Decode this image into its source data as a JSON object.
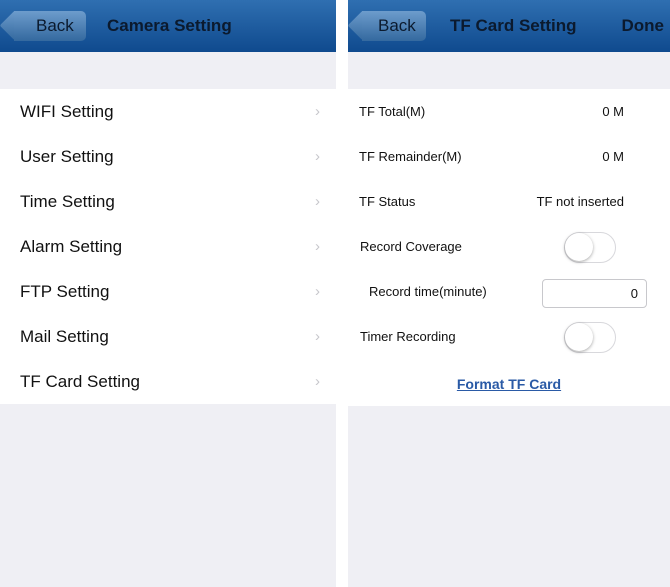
{
  "camera_setting": {
    "back_label": "Back",
    "title": "Camera Setting",
    "items": [
      {
        "label": "WIFI Setting",
        "chevron": "›"
      },
      {
        "label": "User Setting",
        "chevron": "›"
      },
      {
        "label": "Time Setting",
        "chevron": "›"
      },
      {
        "label": "Alarm Setting",
        "chevron": "›"
      },
      {
        "label": "FTP Setting",
        "chevron": "›"
      },
      {
        "label": "Mail Setting",
        "chevron": "›"
      },
      {
        "label": "TF Card Setting",
        "chevron": "›"
      }
    ]
  },
  "tf_card_setting": {
    "back_label": "Back",
    "title": "TF Card Setting",
    "done_label": "Done",
    "tf_total": {
      "label": "TF Total(M)",
      "value": "0 M"
    },
    "tf_remainder": {
      "label": "TF Remainder(M)",
      "value": "0 M"
    },
    "tf_status": {
      "label": "TF Status",
      "value": "TF not inserted"
    },
    "record_coverage": {
      "label": "Record Coverage",
      "on": false
    },
    "record_time": {
      "label": "Record time(minute)",
      "value": "0"
    },
    "timer_recording": {
      "label": "Timer Recording",
      "on": false
    },
    "format_label": "Format TF Card"
  },
  "colors": {
    "navbar_top": "#2f6fb1",
    "navbar_bottom": "#0f4a8e",
    "background": "#efeff4",
    "link": "#2a5aa6"
  },
  "icons": [
    "chevron-right-icon",
    "back-arrow-icon"
  ]
}
